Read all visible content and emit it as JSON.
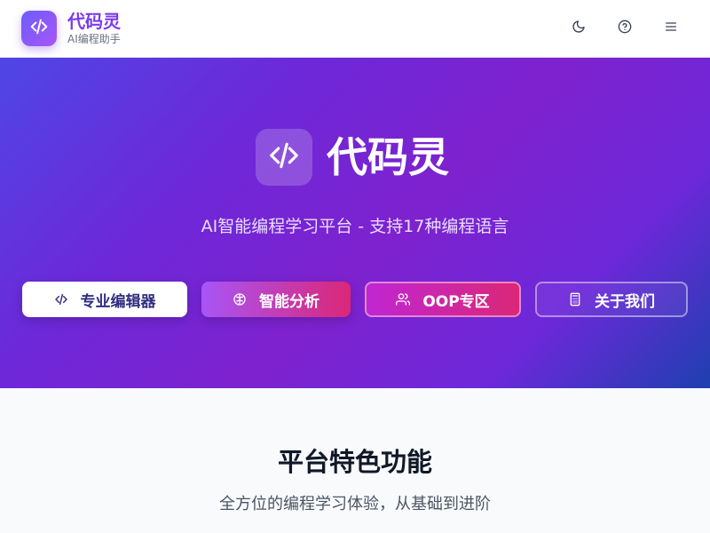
{
  "header": {
    "brand_name": "代码灵",
    "brand_sub": "AI编程助手",
    "icons": [
      "code-icon",
      "moon-icon",
      "help-icon",
      "menu-icon"
    ]
  },
  "hero": {
    "title": "代码灵",
    "subtitle": "AI智能编程学习平台 - 支持17种编程语言",
    "buttons": [
      {
        "label": "专业编辑器",
        "icon": "code-icon"
      },
      {
        "label": "智能分析",
        "icon": "brain-icon"
      },
      {
        "label": "OOP专区",
        "icon": "users-icon"
      },
      {
        "label": "关于我们",
        "icon": "calculator-icon"
      }
    ]
  },
  "features": {
    "title": "平台特色功能",
    "subtitle": "全方位的编程学习体验，从基础到进阶"
  },
  "colors": {
    "brand": "#7c3aed",
    "hero_gradient_start": "#4f46e5",
    "hero_gradient_mid": "#7e22ce",
    "hero_gradient_end": "#1e40af",
    "accent_pink": "#db2777"
  }
}
